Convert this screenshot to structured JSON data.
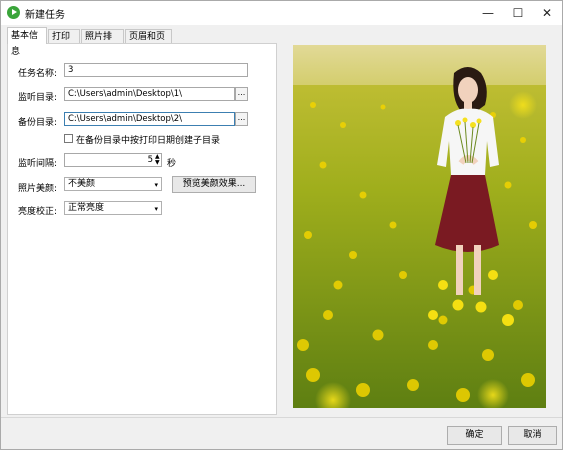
{
  "window": {
    "title": "新建任务",
    "minimize_symbol": "—",
    "maximize_symbol": "☐",
    "close_symbol": "✕",
    "icon": "app-play-icon"
  },
  "tabs": [
    {
      "label": "基本信息",
      "active": true
    },
    {
      "label": "打印机",
      "active": false
    },
    {
      "label": "照片排版",
      "active": false
    },
    {
      "label": "页眉和页脚",
      "active": false
    }
  ],
  "form": {
    "task_name_label": "任务名称:",
    "task_name_value": "3",
    "watch_dir_label": "监听目录:",
    "watch_dir_value": "C:\\Users\\admin\\Desktop\\1\\",
    "backup_dir_label": "备份目录:",
    "backup_dir_value": "C:\\Users\\admin\\Desktop\\2\\",
    "browse_label": "...",
    "date_subdir_checkbox_label": "在备份目录中按打印日期创建子目录",
    "date_subdir_checked": false,
    "interval_label": "监听间隔:",
    "interval_value": "5",
    "interval_unit": "秒",
    "beauty_label": "照片美颜:",
    "beauty_value": "不美颜",
    "preview_beauty_button": "预览美颜效果...",
    "brightness_label": "亮度校正:",
    "brightness_value": "正常亮度"
  },
  "footer": {
    "ok_button": "确定",
    "cancel_button": "取消"
  }
}
